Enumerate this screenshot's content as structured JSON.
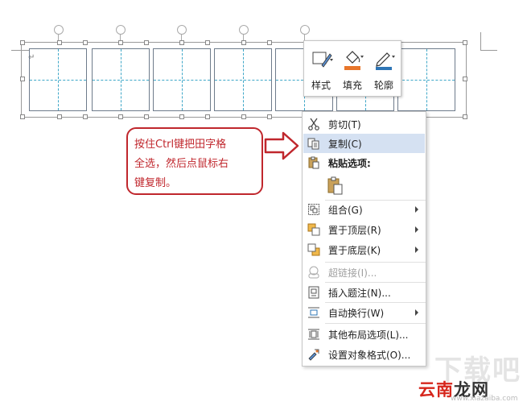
{
  "document": {
    "paragraph_mark": "↵"
  },
  "mini_toolbar": {
    "buttons": [
      {
        "label": "样式",
        "icon": "shape-style-icon"
      },
      {
        "label": "填充",
        "icon": "paint-bucket-icon"
      },
      {
        "label": "轮廓",
        "icon": "pen-outline-icon"
      }
    ],
    "colors": {
      "fill_bar": "#e8762b",
      "outline_bar": "#2e75b6"
    }
  },
  "callout": {
    "line1": "按住Ctrl键把田字格",
    "line2": "全选，然后点鼠标右",
    "line3": "键复制。",
    "color": "#c0272d"
  },
  "context_menu": {
    "items": [
      {
        "label": "剪切(T)",
        "icon": "scissors-icon"
      },
      {
        "label": "复制(C)",
        "icon": "copy-icon"
      },
      {
        "label": "粘贴选项:",
        "icon": "paste-icon"
      },
      {
        "label": "组合(G)",
        "icon": "group-icon"
      },
      {
        "label": "置于顶层(R)",
        "icon": "bring-to-front-icon"
      },
      {
        "label": "置于底层(K)",
        "icon": "send-to-back-icon"
      },
      {
        "label": "超链接(I)...",
        "icon": "hyperlink-icon"
      },
      {
        "label": "插入题注(N)...",
        "icon": "insert-caption-icon"
      },
      {
        "label": "自动换行(W)",
        "icon": "wrap-text-icon"
      },
      {
        "label": "其他布局选项(L)...",
        "icon": "layout-options-icon"
      },
      {
        "label": "设置对象格式(O)...",
        "icon": "format-object-icon"
      }
    ],
    "highlight_color": "#d5e1f2"
  },
  "watermark": {
    "top": "下载吧",
    "logo_red": "云南",
    "logo_dark": "龙网",
    "url": "www.xiazaiba.com"
  }
}
